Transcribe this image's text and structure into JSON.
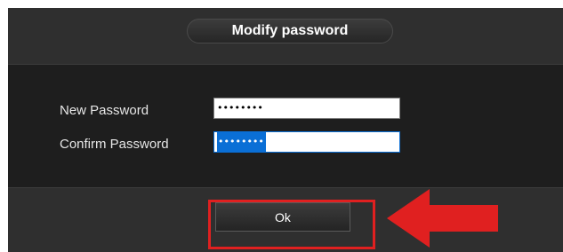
{
  "dialog": {
    "title": "Modify password"
  },
  "form": {
    "new_password": {
      "label": "New Password",
      "value": "••••••••"
    },
    "confirm_password": {
      "label": "Confirm Password",
      "value": "••••••••"
    }
  },
  "actions": {
    "ok_label": "Ok"
  },
  "annotation": {
    "highlight_color": "#e02020",
    "arrow_icon": "red-arrow-left-icon"
  }
}
